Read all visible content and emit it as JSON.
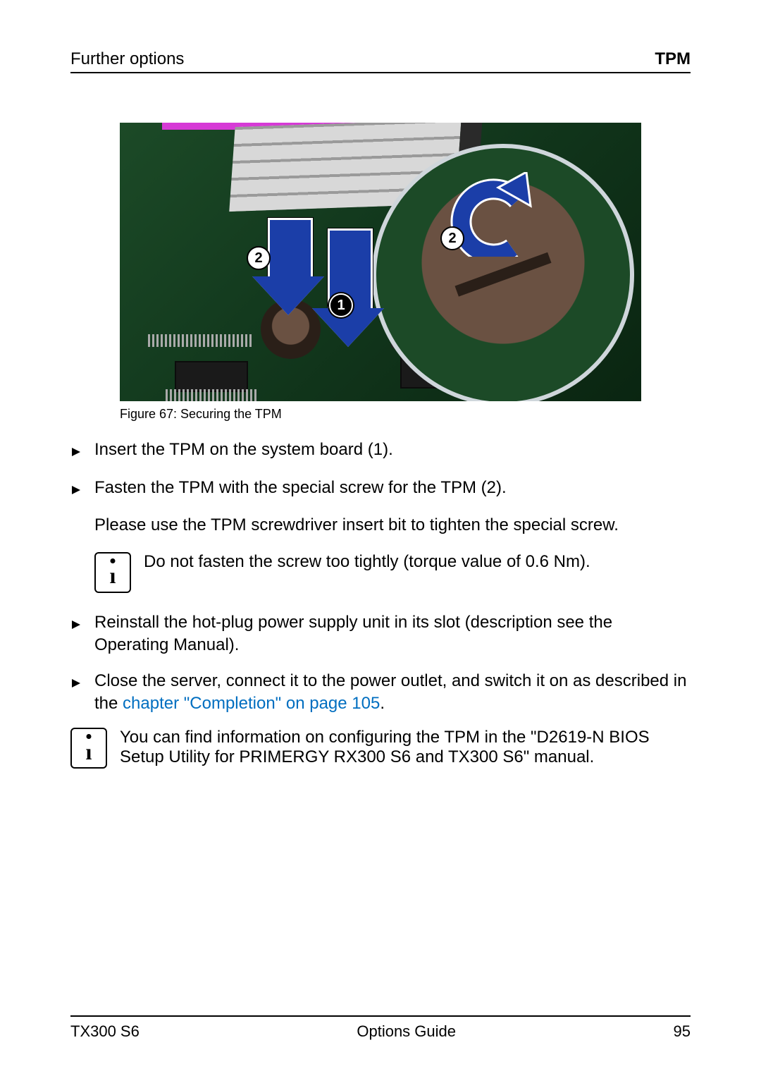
{
  "header": {
    "left": "Further options",
    "right": "TPM"
  },
  "figure": {
    "caption": "Figure 67: Securing the TPM",
    "callouts": {
      "one": "1",
      "two_a": "2",
      "two_b": "2"
    }
  },
  "steps": {
    "s1": "Insert the TPM on the system board (1).",
    "s2": "Fasten the TPM with the special screw for the TPM (2).",
    "s2_note": "Please use the TPM screwdriver insert bit to tighten the special screw.",
    "info1": "Do not fasten the screw too tightly (torque value of 0.6 Nm).",
    "s3": "Reinstall the hot-plug power supply unit in its slot (description see the Operating Manual).",
    "s4_a": "Close the server, connect it to the power outlet, and switch it on as described in the ",
    "s4_link": "chapter \"Completion\" on page 105",
    "s4_b": ".",
    "info2": "You can find information on configuring the TPM in the \"D2619-N BIOS Setup Utility for PRIMERGY RX300 S6 and TX300 S6\" manual."
  },
  "footer": {
    "left": "TX300 S6",
    "center": "Options Guide",
    "right": "95"
  }
}
